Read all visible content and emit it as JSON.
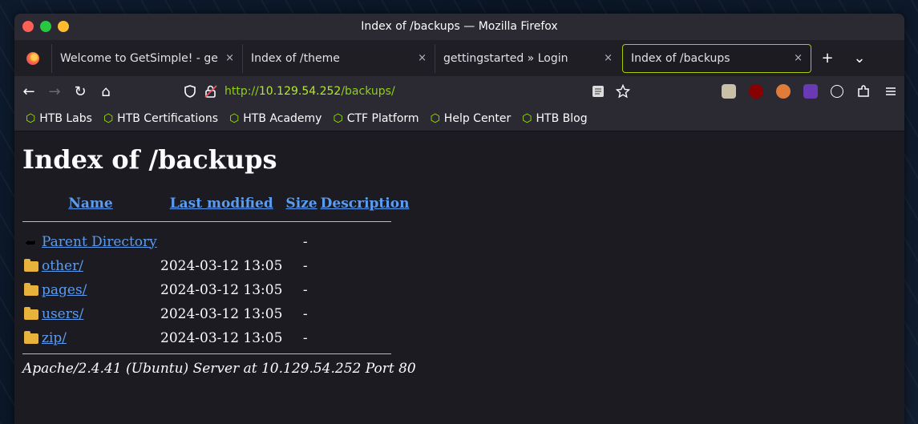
{
  "window": {
    "title": "Index of /backups — Mozilla Firefox"
  },
  "tabs": [
    {
      "label": "Welcome to GetSimple! - ge",
      "close": "×"
    },
    {
      "label": "Index of /theme",
      "close": "×"
    },
    {
      "label": "gettingstarted » Login",
      "close": "×"
    },
    {
      "label": "Index of /backups",
      "close": "×",
      "active": true
    }
  ],
  "tabbar": {
    "new_tab": "+",
    "list_tabs": "⌄"
  },
  "nav": {
    "back": "←",
    "forward": "→",
    "reload": "↻",
    "home": "⌂",
    "url_prefix": "http://",
    "url_host": "10.129.54.252",
    "url_path": "/backups/"
  },
  "bookmarks": [
    {
      "label": "HTB Labs"
    },
    {
      "label": "HTB Certifications"
    },
    {
      "label": "HTB Academy"
    },
    {
      "label": "CTF Platform"
    },
    {
      "label": "Help Center"
    },
    {
      "label": "HTB Blog"
    }
  ],
  "page": {
    "heading": "Index of /backups",
    "columns": {
      "name": "Name",
      "modified": "Last modified",
      "size": "Size",
      "description": "Description"
    },
    "parent": {
      "name": "Parent Directory",
      "size": "-"
    },
    "rows": [
      {
        "name": "other/",
        "modified": "2024-03-12 13:05",
        "size": "-"
      },
      {
        "name": "pages/",
        "modified": "2024-03-12 13:05",
        "size": "-"
      },
      {
        "name": "users/",
        "modified": "2024-03-12 13:05",
        "size": "-"
      },
      {
        "name": "zip/",
        "modified": "2024-03-12 13:05",
        "size": "-"
      }
    ],
    "footer": "Apache/2.4.41 (Ubuntu) Server at 10.129.54.252 Port 80"
  },
  "colors": {
    "accent": "#9fef00",
    "link": "#5b9cf0",
    "active_tab_border": "#a8cc00"
  }
}
